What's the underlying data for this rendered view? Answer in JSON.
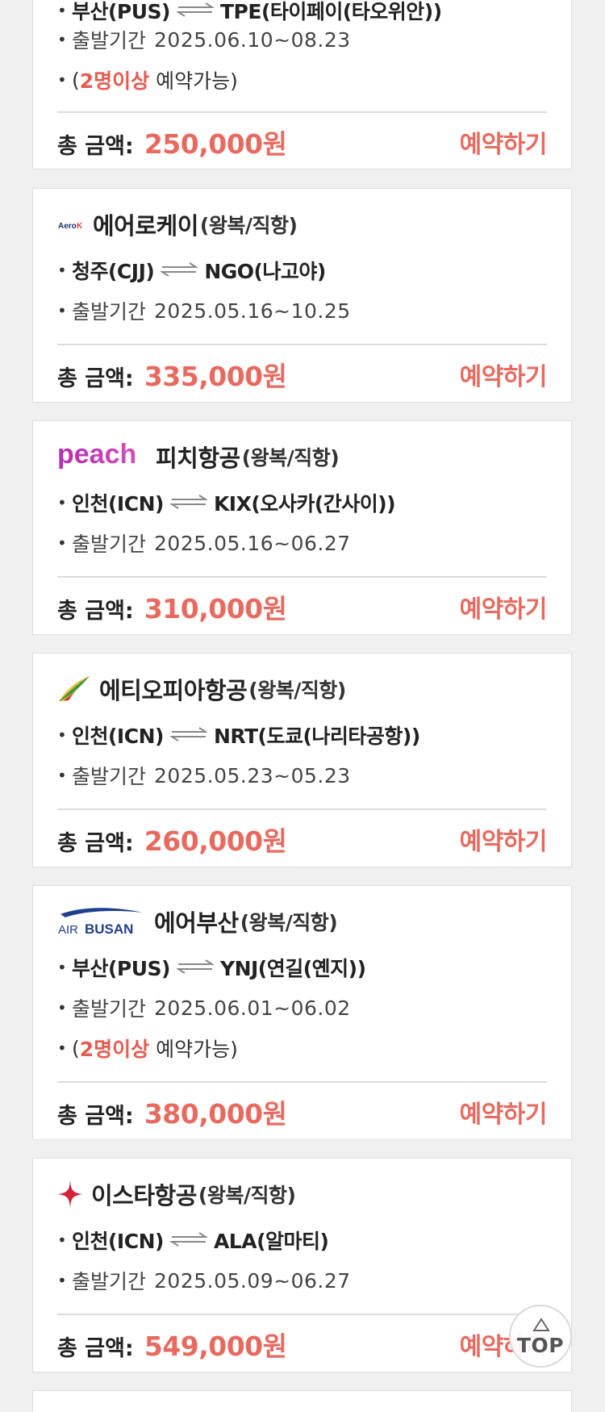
{
  "common": {
    "round_trip_direct": "(왕복/직항)",
    "period_label": "출발기간",
    "price_label": "총 금액:",
    "reserve_label": "예약하기",
    "bullet": "•",
    "min_two_open": "(",
    "min_two_red": "2명이상",
    "min_two_rest": " 예약가능)"
  },
  "cards": [
    {
      "route_from": "부산(PUS)",
      "route_to": "TPE(타이페이(타오위안))",
      "period": "2025.06.10~08.23",
      "price": "250,000원"
    },
    {
      "name": "에어로케이",
      "logo_icon": "aerok-logo-icon",
      "route_from": "청주(CJJ)",
      "route_to": "NGO(나고야)",
      "period": "2025.05.16~10.25",
      "price": "335,000원"
    },
    {
      "name": "피치항공",
      "logo_icon": "peach-logo-icon",
      "logo_text": "peach",
      "route_from": "인천(ICN)",
      "route_to": "KIX(오사카(간사이))",
      "period": "2025.05.16~06.27",
      "price": "310,000원"
    },
    {
      "name": "에티오피아항공",
      "logo_icon": "ethiopian-logo-icon",
      "route_from": "인천(ICN)",
      "route_to": "NRT(도쿄(나리타공항))",
      "period": "2025.05.23~05.23",
      "price": "260,000원"
    },
    {
      "name": "에어부산",
      "logo_icon": "airbusan-logo-icon",
      "logo_text_air": "AIR",
      "logo_text_busan": "BUSAN",
      "route_from": "부산(PUS)",
      "route_to": "YNJ(연길(옌지))",
      "period": "2025.06.01~06.02",
      "price": "380,000원"
    },
    {
      "name": "이스타항공",
      "logo_icon": "eastar-logo-icon",
      "route_from": "인천(ICN)",
      "route_to": "ALA(알마티)",
      "period": "2025.05.09~06.27",
      "price": "549,000원"
    }
  ],
  "top_button": {
    "label": "TOP",
    "icon": "triangle-up-icon"
  },
  "colors": {
    "accent": "#e86a5f",
    "note_red": "#e85a4f",
    "background": "#f0f0f0"
  }
}
